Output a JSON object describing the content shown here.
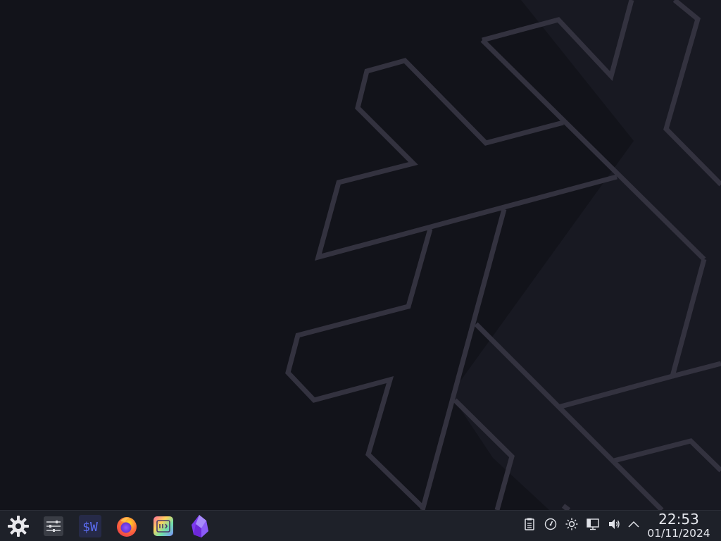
{
  "desktop": {
    "background_color": "#12131a",
    "wallpaper_shape_fill": "#181922",
    "wallpaper_outline_color": "#33323f"
  },
  "taskbar": {
    "background_color": "#1e2129",
    "launchers": [
      {
        "name": "application-launcher",
        "icon": "kde-gear-icon"
      },
      {
        "name": "system-settings",
        "icon": "settings-sliders-icon"
      },
      {
        "name": "terminal-app",
        "icon": "dollar-w-terminal-icon",
        "label": "$W"
      },
      {
        "name": "firefox",
        "icon": "firefox-icon"
      },
      {
        "name": "gradient-app",
        "icon": "rainbow-app-icon"
      },
      {
        "name": "obsidian",
        "icon": "obsidian-crystal-icon"
      }
    ],
    "tray": [
      {
        "name": "clipboard",
        "icon": "clipboard-icon"
      },
      {
        "name": "power-profile",
        "icon": "gauge-icon"
      },
      {
        "name": "brightness",
        "icon": "sun-icon"
      },
      {
        "name": "network",
        "icon": "network-wired-icon"
      },
      {
        "name": "volume",
        "icon": "speaker-icon"
      },
      {
        "name": "show-hidden",
        "icon": "chevron-up-icon"
      }
    ],
    "clock": {
      "time": "22:53",
      "date": "01/11/2024"
    }
  }
}
